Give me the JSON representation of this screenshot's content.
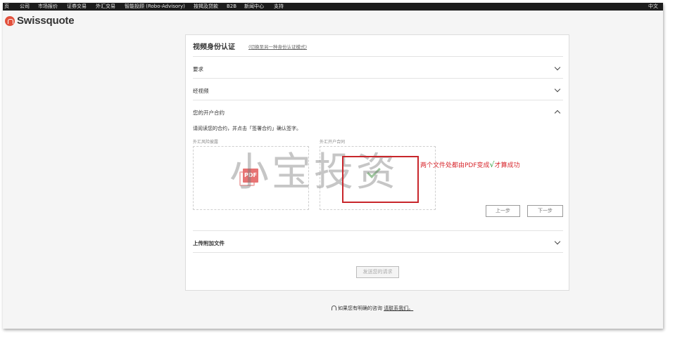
{
  "nav": {
    "items": [
      "页",
      "公司",
      "市场报价",
      "证券交易",
      "外汇交易",
      "智能投顾 (Robo-Advisory)",
      "按揭及贷款",
      "B2B",
      "新闻中心",
      "支持"
    ],
    "lang": "中文"
  },
  "logo": {
    "text": "Swissquote",
    "color": "#e2503c"
  },
  "panel": {
    "title": "视频身份认证",
    "switch_link": "(切换至另一种身份认证模式)",
    "sections": {
      "requirements": "要求",
      "via_video": "经视频",
      "contract": "您的开户合约",
      "upload": "上传附加文件"
    },
    "instruction": "请阅读您的合约，并点击「签署合约」确认签字。",
    "documents": [
      {
        "label": "外汇风险披露",
        "icon": "pdf-icon",
        "icon_text": "PDF"
      },
      {
        "label": "外汇开户合同",
        "icon": "check-icon"
      }
    ],
    "prev_button": "上一步",
    "next_button": "下一步",
    "submit_button": "发送您的请求"
  },
  "help": {
    "text": "如果您有明确的咨询",
    "link": "请联系我们。"
  },
  "overlay": {
    "watermark": "小宝投资",
    "annotation": "两个文件处都由PDF变成",
    "annotation_mark": "√",
    "annotation_tail": "才算成功",
    "annotation_color": "#d8292f"
  }
}
